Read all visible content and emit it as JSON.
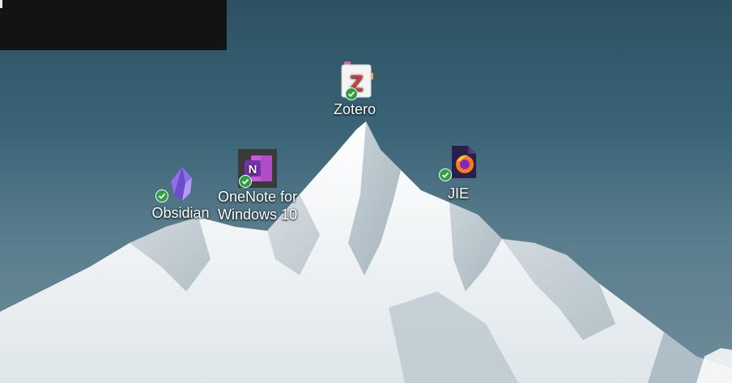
{
  "desktop": {
    "icons": [
      {
        "label": "Zotero",
        "icon": "zotero-icon",
        "sync_status": "synced"
      },
      {
        "label": "OneNote for Windows 10",
        "label_lines": [
          "OneNote for",
          "Windows 10"
        ],
        "icon": "onenote-icon",
        "sync_status": "synced"
      },
      {
        "label": "Obsidian",
        "icon": "obsidian-icon",
        "sync_status": "synced"
      },
      {
        "label": "JIE",
        "icon": "firefox-file-icon",
        "sync_status": "synced"
      }
    ],
    "colors": {
      "sky": "#2c5163",
      "snow": "#f4f6f7",
      "sync_badge": "#2ea043",
      "zotero_red": "#d9373c",
      "onenote_purple": "#7a2fb0",
      "obsidian_purple": "#8f6ee8"
    }
  }
}
